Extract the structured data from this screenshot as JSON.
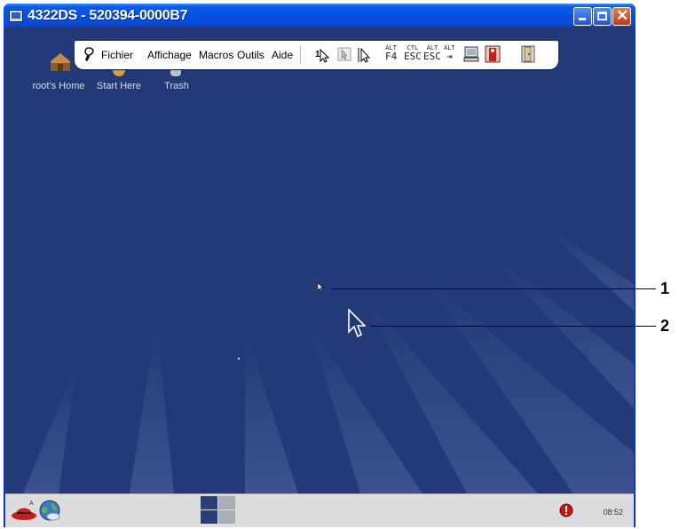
{
  "window": {
    "title": "4322DS - 520394-0000B7",
    "buttons": [
      "minimize",
      "maximize",
      "close"
    ]
  },
  "toolbar": {
    "menus": [
      "Fichier",
      "Affichage",
      "Macros",
      "Outils",
      "Aide"
    ],
    "keys": [
      {
        "small": "ALT",
        "big": "F4"
      },
      {
        "small": "CTL",
        "big": "ESC"
      },
      {
        "small": "ALT",
        "big": "ESC"
      },
      {
        "small": "ALT",
        "big": "⇥"
      }
    ]
  },
  "desktop": {
    "icons": [
      {
        "label": "root's Home",
        "icon": "home-folder-icon"
      },
      {
        "label": "Start Here",
        "icon": "start-here-icon"
      },
      {
        "label": "Trash",
        "icon": "trash-icon"
      }
    ]
  },
  "taskbar": {
    "clock": "08:52"
  },
  "callouts": [
    "1",
    "2"
  ],
  "colors": {
    "titlebar": "#0550e0",
    "desktop": "#243a78",
    "close_button": "#c2381a",
    "taskbar": "#dcdcdc"
  }
}
